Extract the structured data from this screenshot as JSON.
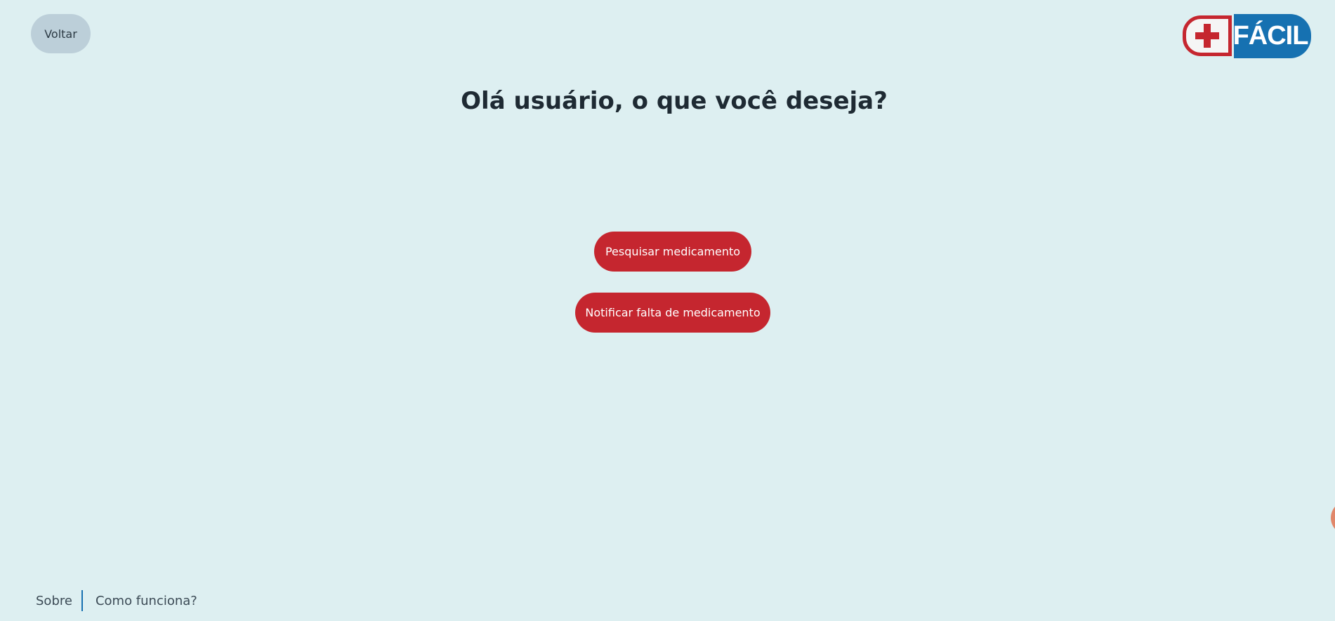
{
  "header": {
    "back_label": "Voltar",
    "logo_text": "FÁCIL",
    "logo_icon": "plus-icon"
  },
  "main": {
    "title": "Olá usuário, o que você deseja?",
    "actions": [
      {
        "label": "Pesquisar medicamento"
      },
      {
        "label": "Notificar falta de medicamento"
      }
    ]
  },
  "footer": {
    "links": [
      {
        "label": "Sobre"
      },
      {
        "label": "Como funciona?"
      }
    ]
  },
  "colors": {
    "background": "#ddeff1",
    "primary_red": "#c5262f",
    "brand_blue": "#1671b1",
    "back_button": "#bccfd9",
    "title_text": "#1e2a33"
  }
}
